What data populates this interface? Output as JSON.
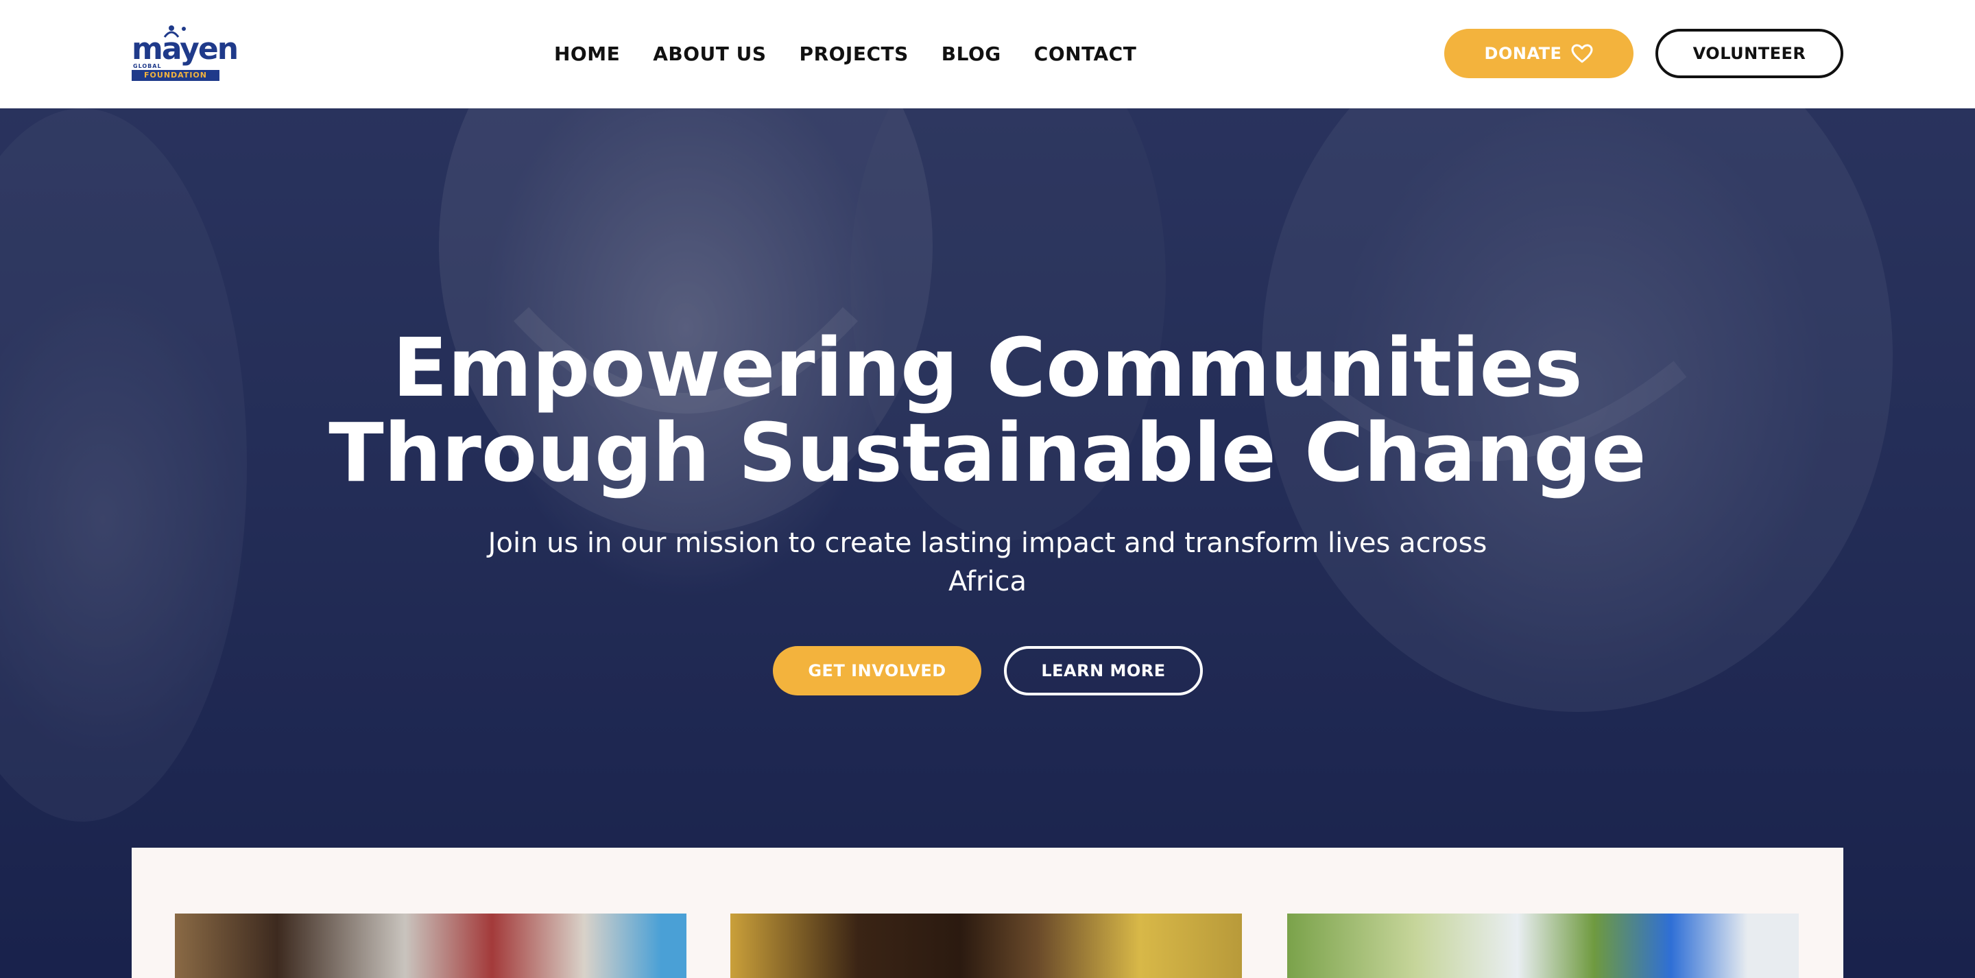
{
  "brand": {
    "logo_word": "mayen",
    "logo_global": "GLOBAL",
    "logo_band": "FOUNDATION",
    "primary_color": "#1f3a8a",
    "accent_color": "#f3b33d"
  },
  "nav": {
    "items": [
      {
        "label": "HOME"
      },
      {
        "label": "ABOUT US"
      },
      {
        "label": "PROJECTS"
      },
      {
        "label": "BLOG"
      },
      {
        "label": "CONTACT"
      }
    ]
  },
  "header_actions": {
    "donate_label": "DONATE",
    "donate_icon": "heart-icon",
    "volunteer_label": "VOLUNTEER"
  },
  "hero": {
    "title_line1": "Empowering Communities",
    "title_line2": "Through Sustainable Change",
    "subtitle": "Join us in our mission to create lasting impact and transform lives across Africa",
    "primary_cta": "GET INVOLVED",
    "secondary_cta": "LEARN MORE"
  },
  "cards": [
    {
      "image": "children-health-photo"
    },
    {
      "image": "child-portrait-photo"
    },
    {
      "image": "medical-outreach-photo"
    }
  ]
}
